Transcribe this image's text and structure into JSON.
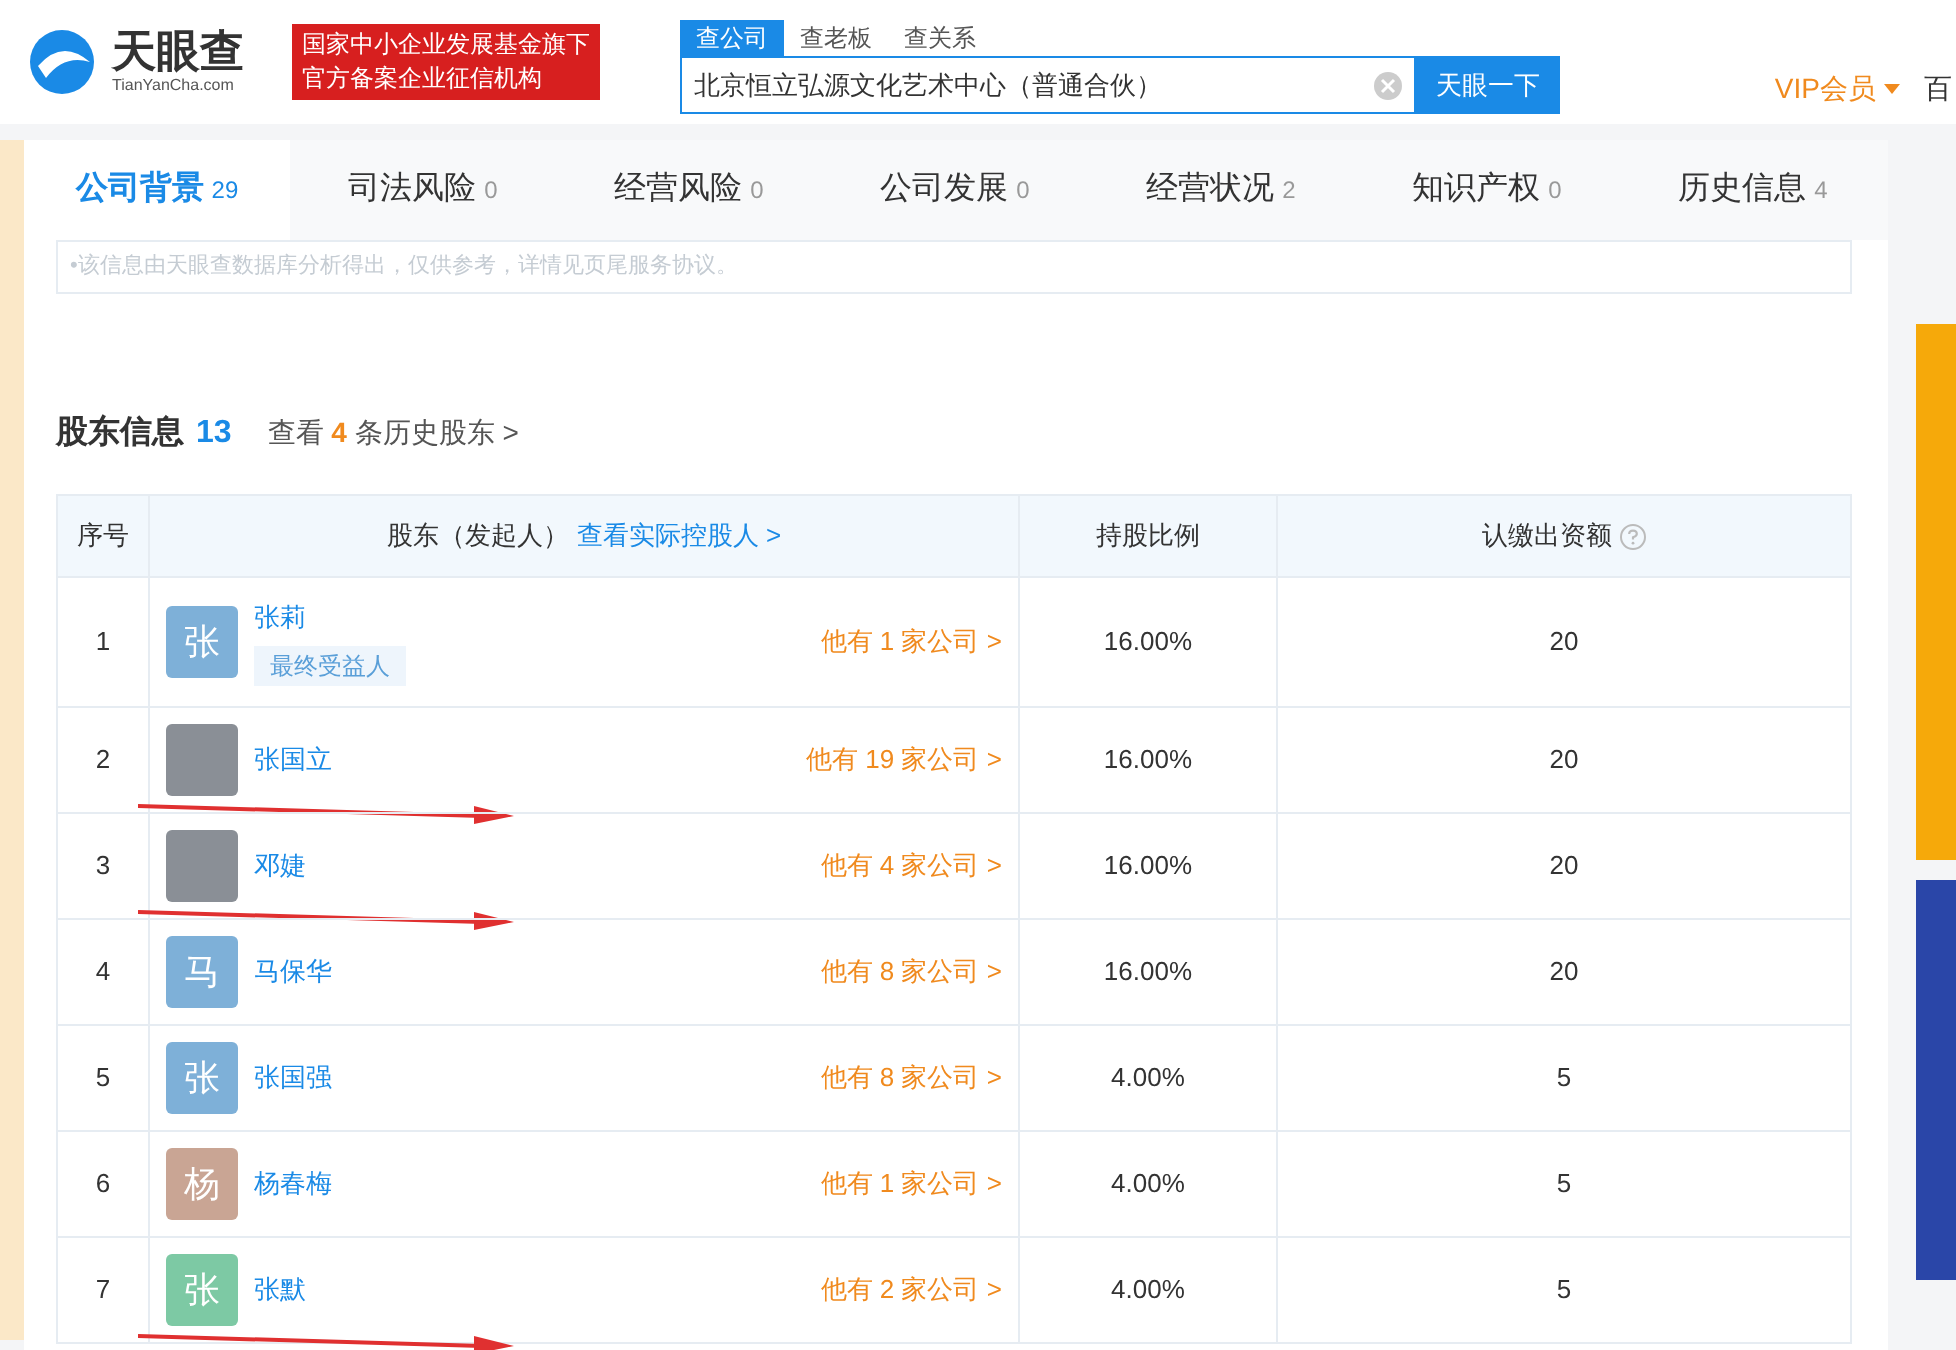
{
  "header": {
    "logo_text": "天眼查",
    "logo_subtext": "TianYanCha.com",
    "badge_lines": [
      "国家中小企业发展基金旗下",
      "官方备案企业征信机构"
    ],
    "search_tabs": [
      {
        "label": "查公司",
        "selected": true
      },
      {
        "label": "查老板",
        "selected": false
      },
      {
        "label": "查关系",
        "selected": false
      }
    ],
    "search_value": "北京恒立弘源文化艺术中心（普通合伙）",
    "search_button": "天眼一下",
    "vip": "VIP会员",
    "edge_text": "百"
  },
  "tabs": [
    {
      "label": "公司背景",
      "count": "29",
      "selected": true
    },
    {
      "label": "司法风险",
      "count": "0",
      "selected": false
    },
    {
      "label": "经营风险",
      "count": "0",
      "selected": false
    },
    {
      "label": "公司发展",
      "count": "0",
      "selected": false
    },
    {
      "label": "经营状况",
      "count": "2",
      "selected": false
    },
    {
      "label": "知识产权",
      "count": "0",
      "selected": false
    },
    {
      "label": "历史信息",
      "count": "4",
      "selected": false
    }
  ],
  "notice": "•该信息由天眼查数据库分析得出，仅供参考，详情见页尾服务协议。",
  "section": {
    "title": "股东信息",
    "count": "13",
    "history_prefix": "查看",
    "history_count": "4",
    "history_suffix": "条历史股东 >"
  },
  "table": {
    "columns": [
      "序号",
      "股东（发起人）",
      "持股比例",
      "认缴出资额"
    ],
    "controller_link": "查看实际控股人 >",
    "rows": [
      {
        "index": "1",
        "kind": "letter",
        "avatar": "张",
        "color": "#7eb0d8",
        "name": "张莉",
        "tag": "最终受益人",
        "companies": "他有 1 家公司 >",
        "ratio": "16.00%",
        "amount": "20",
        "arrow": false
      },
      {
        "index": "2",
        "kind": "photo",
        "name": "张国立",
        "companies": "他有 19 家公司 >",
        "ratio": "16.00%",
        "amount": "20",
        "arrow": true
      },
      {
        "index": "3",
        "kind": "photo",
        "name": "邓婕",
        "companies": "他有 4 家公司 >",
        "ratio": "16.00%",
        "amount": "20",
        "arrow": true
      },
      {
        "index": "4",
        "kind": "letter",
        "avatar": "马",
        "color": "#7eb0d8",
        "name": "马保华",
        "companies": "他有 8 家公司 >",
        "ratio": "16.00%",
        "amount": "20",
        "arrow": false
      },
      {
        "index": "5",
        "kind": "letter",
        "avatar": "张",
        "color": "#7eb0d8",
        "name": "张国强",
        "companies": "他有 8 家公司 >",
        "ratio": "4.00%",
        "amount": "5",
        "arrow": false
      },
      {
        "index": "6",
        "kind": "letter",
        "avatar": "杨",
        "color": "#c9a594",
        "name": "杨春梅",
        "companies": "他有 1 家公司 >",
        "ratio": "4.00%",
        "amount": "5",
        "arrow": false
      },
      {
        "index": "7",
        "kind": "letter",
        "avatar": "张",
        "color": "#7dc9a4",
        "name": "张默",
        "companies": "他有 2 家公司 >",
        "ratio": "4.00%",
        "amount": "5",
        "arrow": true
      }
    ]
  }
}
